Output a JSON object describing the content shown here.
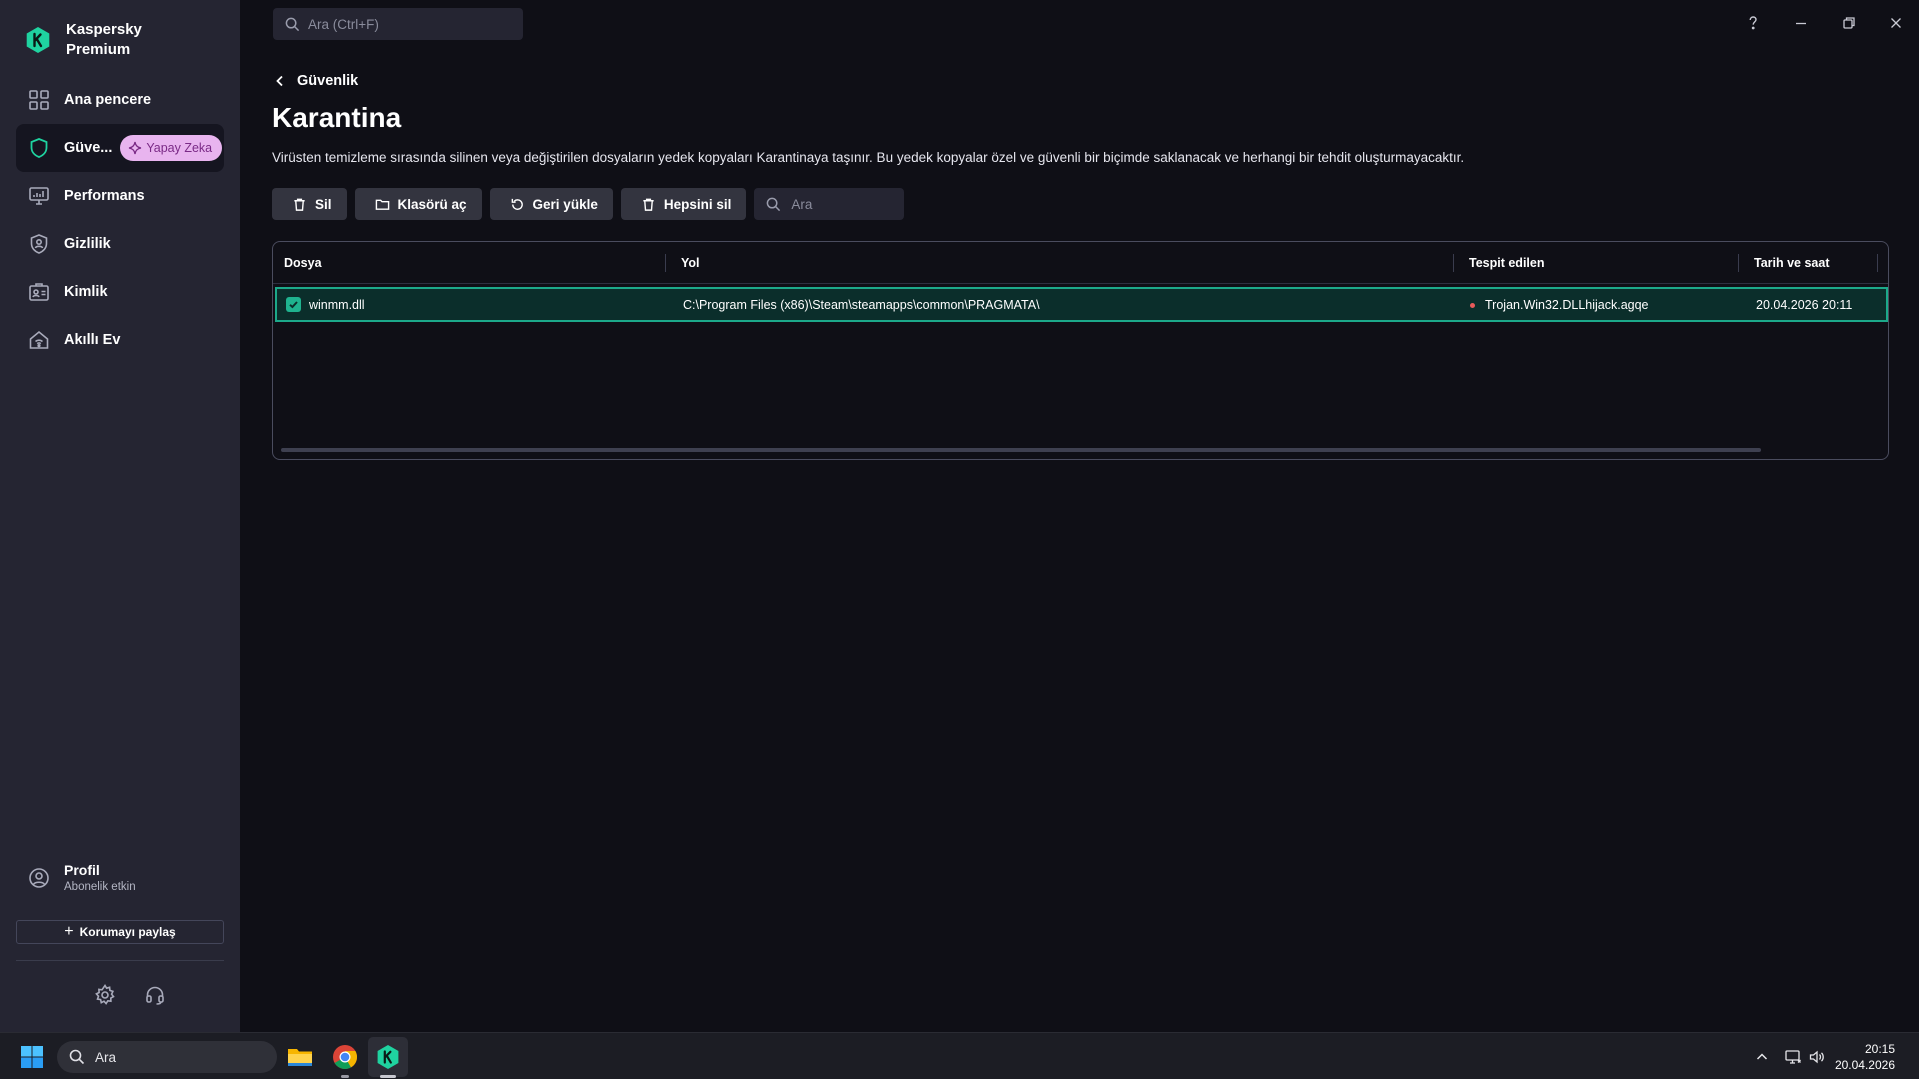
{
  "app": {
    "name": "Kaspersky Premium",
    "brand_color": "#1fd3a0"
  },
  "sidebar": {
    "items": [
      {
        "label": "Ana pencere",
        "icon": "dashboard-icon"
      },
      {
        "label": "Güve...",
        "icon": "shield-icon",
        "active": true,
        "badge": "Yapay Zeka"
      },
      {
        "label": "Performans",
        "icon": "performance-icon"
      },
      {
        "label": "Gizlilik",
        "icon": "privacy-icon"
      },
      {
        "label": "Kimlik",
        "icon": "identity-icon"
      },
      {
        "label": "Akıllı Ev",
        "icon": "smart-home-icon"
      }
    ],
    "profile": {
      "title": "Profil",
      "subtitle": "Abonelik etkin"
    },
    "share_button": "Korumayı paylaş",
    "bottom_icons": [
      "gear-icon",
      "headset-icon"
    ]
  },
  "topbar": {
    "search_placeholder": "Ara (Ctrl+F)"
  },
  "main": {
    "breadcrumb": "Güvenlik",
    "title": "Karantina",
    "description": "Virüsten temizleme sırasında silinen veya değiştirilen dosyaların yedek kopyaları Karantinaya taşınır. Bu yedek kopyalar özel ve güvenli bir biçimde saklanacak ve herhangi bir tehdit oluşturmayacaktır.",
    "toolbar": {
      "delete": "Sil",
      "open_folder": "Klasörü aç",
      "restore": "Geri yükle",
      "delete_all": "Hepsini sil",
      "search_placeholder": "Ara"
    },
    "table": {
      "columns": [
        "Dosya",
        "Yol",
        "Tespit edilen",
        "Tarih ve saat"
      ],
      "rows": [
        {
          "file": "winmm.dll",
          "path": "C:\\Program Files (x86)\\Steam\\steamapps\\common\\PRAGMATA\\",
          "detected": "Trojan.Win32.DLLhijack.agqe",
          "datetime": "20.04.2026 20:11",
          "selected": true
        }
      ]
    }
  },
  "taskbar": {
    "search_label": "Ara",
    "apps": [
      "file-explorer-icon",
      "chrome-icon",
      "kaspersky-icon"
    ],
    "time": "20:15",
    "date": "20.04.2026"
  }
}
